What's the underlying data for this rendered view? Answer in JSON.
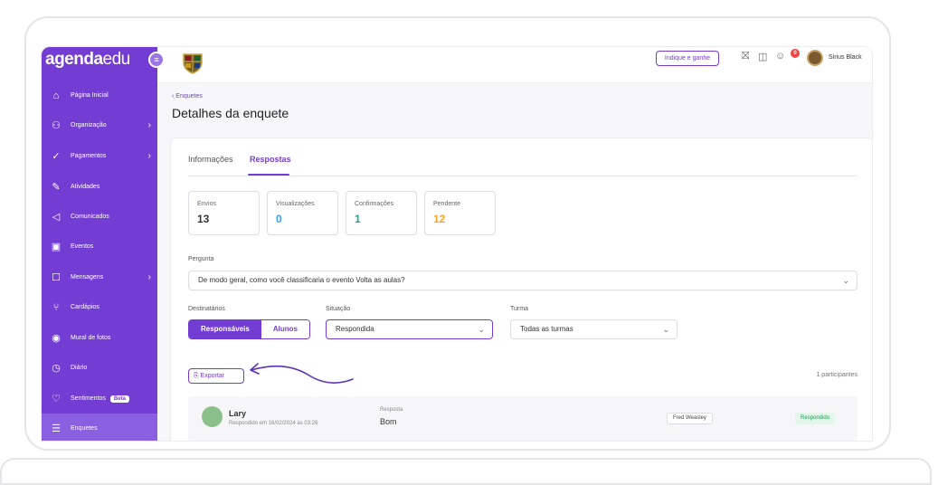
{
  "sidebar": {
    "logo_bold": "agenda",
    "logo_light": "edu",
    "items": [
      {
        "label": "Página Inicial",
        "icon": "home-icon",
        "glyph": "⌂",
        "arrow": ""
      },
      {
        "label": "Organização",
        "icon": "org-chart-icon",
        "glyph": "⚇",
        "arrow": "›"
      },
      {
        "label": "Pagamentos",
        "icon": "check-icon",
        "glyph": "✓",
        "arrow": "›"
      },
      {
        "label": "Atividades",
        "icon": "pencil-icon",
        "glyph": "✎",
        "arrow": ""
      },
      {
        "label": "Comunicados",
        "icon": "megaphone-icon",
        "glyph": "◁",
        "arrow": ""
      },
      {
        "label": "Eventos",
        "icon": "calendar-icon",
        "glyph": "▣",
        "arrow": ""
      },
      {
        "label": "Mensagens",
        "icon": "chat-icon",
        "glyph": "☐",
        "arrow": "›"
      },
      {
        "label": "Cardápios",
        "icon": "utensils-icon",
        "glyph": "⑂",
        "arrow": ""
      },
      {
        "label": "Mural de fotos",
        "icon": "camera-icon",
        "glyph": "◉",
        "arrow": ""
      },
      {
        "label": "Diário",
        "icon": "clock-icon",
        "glyph": "◷",
        "arrow": ""
      },
      {
        "label": "Sentimentos",
        "icon": "heart-chat-icon",
        "glyph": "♡",
        "arrow": "",
        "badge": "Beta"
      },
      {
        "label": "Enquetes",
        "icon": "list-icon",
        "glyph": "☰",
        "arrow": "",
        "active": true
      }
    ]
  },
  "header": {
    "refer_label": "Indique e ganhe",
    "notif_count": "0",
    "user_name": "Sirius Black"
  },
  "main": {
    "breadcrumb": "‹ Enquetes",
    "title": "Detalhes da enquete",
    "tabs": [
      "Informações",
      "Respostas"
    ],
    "stats": [
      {
        "label": "Envios",
        "value": "13",
        "color": "#333333"
      },
      {
        "label": "Visualizações",
        "value": "0",
        "color": "#3aa0e8"
      },
      {
        "label": "Confirmações",
        "value": "1",
        "color": "#1ba39c"
      },
      {
        "label": "Pendente",
        "value": "12",
        "color": "#f5a623"
      }
    ],
    "question_label": "Pergunta",
    "question_value": "De modo geral, como você classificaria o evento Volta as aulas?",
    "recipients_label": "Destinatários",
    "recipients_options": [
      "Responsáveis",
      "Alunos"
    ],
    "situation_label": "Situação",
    "situation_value": "Respondida",
    "class_label": "Turma",
    "class_value": "Todas as turmas",
    "export_label": "⎘ Exportar",
    "participants": "1 participantes",
    "rows": [
      {
        "name": "Lary",
        "date": "Respondido em 16/02/2024 às 03:26",
        "answer_label": "Resposta",
        "answer": "Bom",
        "student": "Fred Weasley",
        "status": "Respondido"
      }
    ]
  },
  "colors": {
    "brand": "#733dd3",
    "success": "#1f9a4d"
  }
}
